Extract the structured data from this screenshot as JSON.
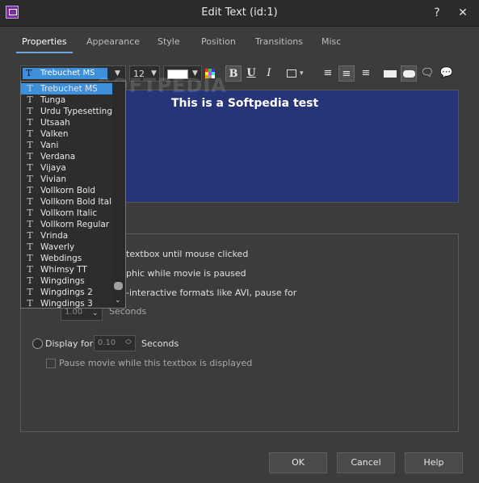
{
  "window": {
    "title": "Edit Text (id:1)",
    "help": "?",
    "close": "✕"
  },
  "tabs": [
    "Properties",
    "Appearance",
    "Style",
    "Position",
    "Transitions",
    "Misc"
  ],
  "toolbar": {
    "font": "Trebuchet MS",
    "size": "12",
    "bold": "B",
    "underline": "U",
    "italic": "I"
  },
  "preview": {
    "text": "This is a Softpedia test",
    "background": "#263577"
  },
  "font_list": {
    "selected": "Trebuchet MS",
    "items": [
      "Trebuchet MS",
      "Tunga",
      "Urdu Typesetting",
      "Utsaah",
      "Valken",
      "Vani",
      "Verdana",
      "Vijaya",
      "Vivian",
      "Vollkorn Bold",
      "Vollkorn Bold Italic",
      "Vollkorn Italic",
      "Vollkorn Regular",
      "Vrinda",
      "Waverly",
      "Webdings",
      "Whimsy TT",
      "Wingdings",
      "Wingdings 2",
      "Wingdings 3"
    ]
  },
  "options": {
    "line1": "textbox until mouse clicked",
    "line2": "phic while movie is paused",
    "line3": "-interactive formats like AVI, pause for",
    "pause_value": "1.00",
    "pause_unit": "Seconds",
    "display_for_label": "Display for",
    "display_value": "0.10",
    "display_unit": "Seconds",
    "pause_movie_label": "Pause movie while this textbox is displayed"
  },
  "buttons": {
    "ok": "OK",
    "cancel": "Cancel",
    "help": "Help"
  },
  "watermark": "SOFTPEDIA",
  "colors": {
    "accent": "#3d8fd9",
    "dialog_bg": "#3c3c3c"
  }
}
